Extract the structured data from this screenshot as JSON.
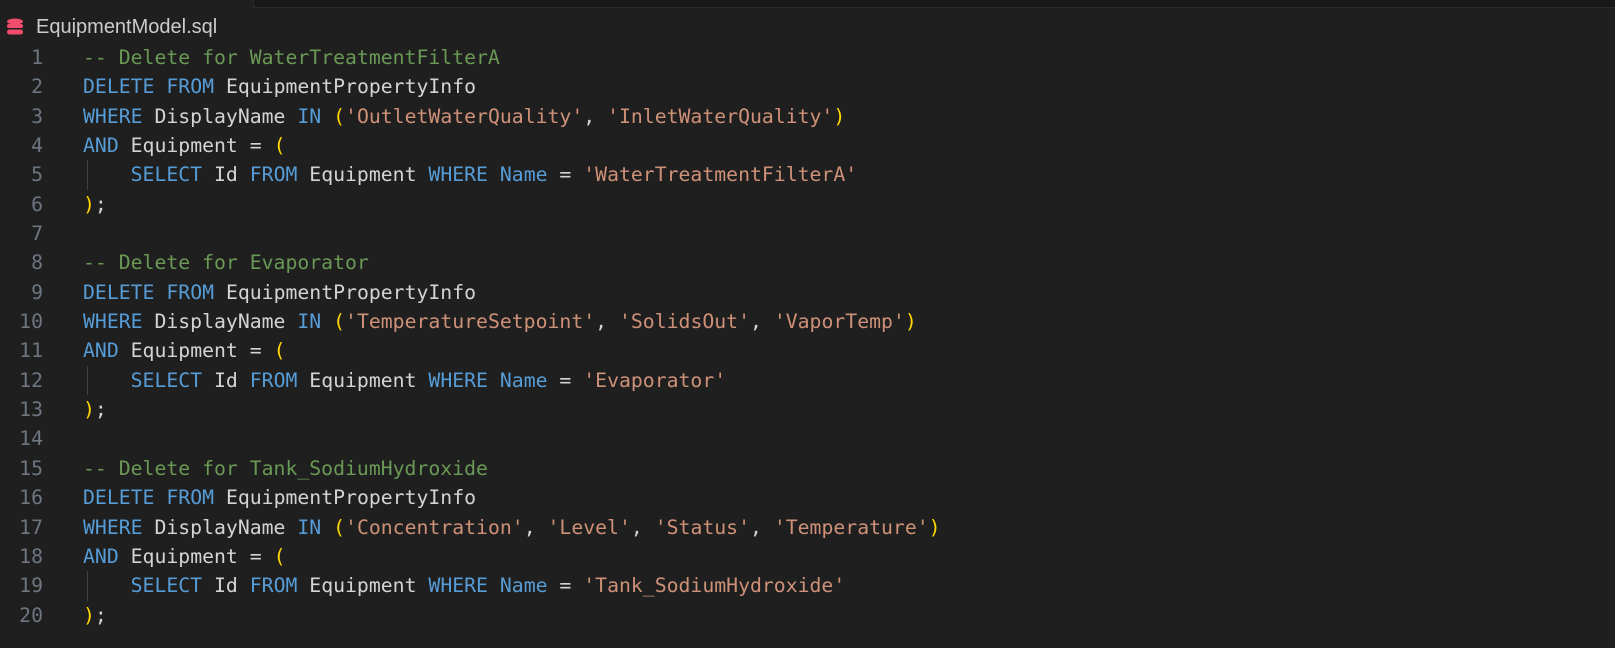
{
  "tab": {
    "title": "EquipmentModel.sql",
    "icon": "database-icon",
    "icon_color": "#f14c6c"
  },
  "colors": {
    "comment": "#6a9955",
    "keyword": "#569cd6",
    "ident": "#d4d4d4",
    "string": "#ce9178",
    "paren": "#ffd700"
  },
  "lines": [
    {
      "n": "1",
      "indent": false,
      "tokens": [
        [
          "comment",
          "-- Delete for WaterTreatmentFilterA"
        ]
      ]
    },
    {
      "n": "2",
      "indent": false,
      "tokens": [
        [
          "keyword",
          "DELETE"
        ],
        [
          "punct",
          " "
        ],
        [
          "keyword",
          "FROM"
        ],
        [
          "ident",
          " EquipmentPropertyInfo"
        ]
      ]
    },
    {
      "n": "3",
      "indent": false,
      "tokens": [
        [
          "keyword",
          "WHERE"
        ],
        [
          "ident",
          " DisplayName "
        ],
        [
          "keyword",
          "IN"
        ],
        [
          "punct",
          " "
        ],
        [
          "paren",
          "("
        ],
        [
          "string",
          "'OutletWaterQuality'"
        ],
        [
          "punct",
          ", "
        ],
        [
          "string",
          "'InletWaterQuality'"
        ],
        [
          "paren",
          ")"
        ]
      ]
    },
    {
      "n": "4",
      "indent": false,
      "tokens": [
        [
          "keyword",
          "AND"
        ],
        [
          "ident",
          " Equipment = "
        ],
        [
          "paren",
          "("
        ]
      ]
    },
    {
      "n": "5",
      "indent": true,
      "tokens": [
        [
          "punct",
          "    "
        ],
        [
          "keyword",
          "SELECT"
        ],
        [
          "ident",
          " Id "
        ],
        [
          "keyword",
          "FROM"
        ],
        [
          "ident",
          " Equipment "
        ],
        [
          "keyword",
          "WHERE"
        ],
        [
          "punct",
          " "
        ],
        [
          "keyword",
          "Name"
        ],
        [
          "ident",
          " = "
        ],
        [
          "string",
          "'WaterTreatmentFilterA'"
        ]
      ]
    },
    {
      "n": "6",
      "indent": false,
      "tokens": [
        [
          "paren",
          ")"
        ],
        [
          "punct",
          ";"
        ]
      ]
    },
    {
      "n": "7",
      "indent": false,
      "tokens": []
    },
    {
      "n": "8",
      "indent": false,
      "tokens": [
        [
          "comment",
          "-- Delete for Evaporator"
        ]
      ]
    },
    {
      "n": "9",
      "indent": false,
      "tokens": [
        [
          "keyword",
          "DELETE"
        ],
        [
          "punct",
          " "
        ],
        [
          "keyword",
          "FROM"
        ],
        [
          "ident",
          " EquipmentPropertyInfo"
        ]
      ]
    },
    {
      "n": "10",
      "indent": false,
      "tokens": [
        [
          "keyword",
          "WHERE"
        ],
        [
          "ident",
          " DisplayName "
        ],
        [
          "keyword",
          "IN"
        ],
        [
          "punct",
          " "
        ],
        [
          "paren",
          "("
        ],
        [
          "string",
          "'TemperatureSetpoint'"
        ],
        [
          "punct",
          ", "
        ],
        [
          "string",
          "'SolidsOut'"
        ],
        [
          "punct",
          ", "
        ],
        [
          "string",
          "'VaporTemp'"
        ],
        [
          "paren",
          ")"
        ]
      ]
    },
    {
      "n": "11",
      "indent": false,
      "tokens": [
        [
          "keyword",
          "AND"
        ],
        [
          "ident",
          " Equipment = "
        ],
        [
          "paren",
          "("
        ]
      ]
    },
    {
      "n": "12",
      "indent": true,
      "tokens": [
        [
          "punct",
          "    "
        ],
        [
          "keyword",
          "SELECT"
        ],
        [
          "ident",
          " Id "
        ],
        [
          "keyword",
          "FROM"
        ],
        [
          "ident",
          " Equipment "
        ],
        [
          "keyword",
          "WHERE"
        ],
        [
          "punct",
          " "
        ],
        [
          "keyword",
          "Name"
        ],
        [
          "ident",
          " = "
        ],
        [
          "string",
          "'Evaporator'"
        ]
      ]
    },
    {
      "n": "13",
      "indent": false,
      "tokens": [
        [
          "paren",
          ")"
        ],
        [
          "punct",
          ";"
        ]
      ]
    },
    {
      "n": "14",
      "indent": false,
      "tokens": []
    },
    {
      "n": "15",
      "indent": false,
      "tokens": [
        [
          "comment",
          "-- Delete for Tank_SodiumHydroxide"
        ]
      ]
    },
    {
      "n": "16",
      "indent": false,
      "tokens": [
        [
          "keyword",
          "DELETE"
        ],
        [
          "punct",
          " "
        ],
        [
          "keyword",
          "FROM"
        ],
        [
          "ident",
          " EquipmentPropertyInfo"
        ]
      ]
    },
    {
      "n": "17",
      "indent": false,
      "tokens": [
        [
          "keyword",
          "WHERE"
        ],
        [
          "ident",
          " DisplayName "
        ],
        [
          "keyword",
          "IN"
        ],
        [
          "punct",
          " "
        ],
        [
          "paren",
          "("
        ],
        [
          "string",
          "'Concentration'"
        ],
        [
          "punct",
          ", "
        ],
        [
          "string",
          "'Level'"
        ],
        [
          "punct",
          ", "
        ],
        [
          "string",
          "'Status'"
        ],
        [
          "punct",
          ", "
        ],
        [
          "string",
          "'Temperature'"
        ],
        [
          "paren",
          ")"
        ]
      ]
    },
    {
      "n": "18",
      "indent": false,
      "tokens": [
        [
          "keyword",
          "AND"
        ],
        [
          "ident",
          " Equipment = "
        ],
        [
          "paren",
          "("
        ]
      ]
    },
    {
      "n": "19",
      "indent": true,
      "tokens": [
        [
          "punct",
          "    "
        ],
        [
          "keyword",
          "SELECT"
        ],
        [
          "ident",
          " Id "
        ],
        [
          "keyword",
          "FROM"
        ],
        [
          "ident",
          " Equipment "
        ],
        [
          "keyword",
          "WHERE"
        ],
        [
          "punct",
          " "
        ],
        [
          "keyword",
          "Name"
        ],
        [
          "ident",
          " = "
        ],
        [
          "string",
          "'Tank_SodiumHydroxide'"
        ]
      ]
    },
    {
      "n": "20",
      "indent": false,
      "tokens": [
        [
          "paren",
          ")"
        ],
        [
          "punct",
          ";"
        ]
      ]
    }
  ]
}
